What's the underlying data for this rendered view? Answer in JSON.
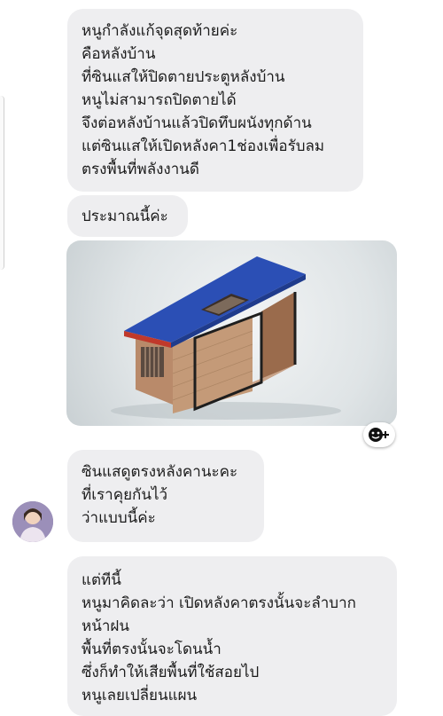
{
  "messages": [
    {
      "text": "หนูกำลังแก้จุดสุดท้ายค่ะ\nคือหลังบ้าน\nที่ซินแสให้ปิดตายประตูหลังบ้าน\nหนูไม่สามารถปิดตายได้\nจึงต่อหลังบ้านแล้วปิดทึบผนังทุกด้าน\nแต่ซินแสให้เปิดหลังคา1ช่องเพื่อรับลม\nตรงพื้นที่พลังงานดี"
    },
    {
      "text": "ประมาณนี้ค่ะ"
    },
    {
      "text": "ซินแสดูตรงหลังคานะคะ\nที่เราคุยกันไว้\nว่าแบบนี้ค่ะ"
    },
    {
      "text": "แต่ทีนี้\nหนูมาคิดละว่า เปิดหลังคาตรงนั้นจะลำบาก\nหน้าฝน\nพื้นที่ตรงนั้นจะโดนน้ำ\nซึ่งก็ทำให้เสียพื้นที่ใช้สอยไป\nหนูเลยเปลี่ยนแผน"
    }
  ],
  "icons": {
    "reaction": "smiley-plus-icon",
    "avatar": "user-avatar"
  },
  "colors": {
    "bubble": "#eeeef0",
    "roof": "#2b4fb5",
    "roof_trim": "#c0392b"
  }
}
